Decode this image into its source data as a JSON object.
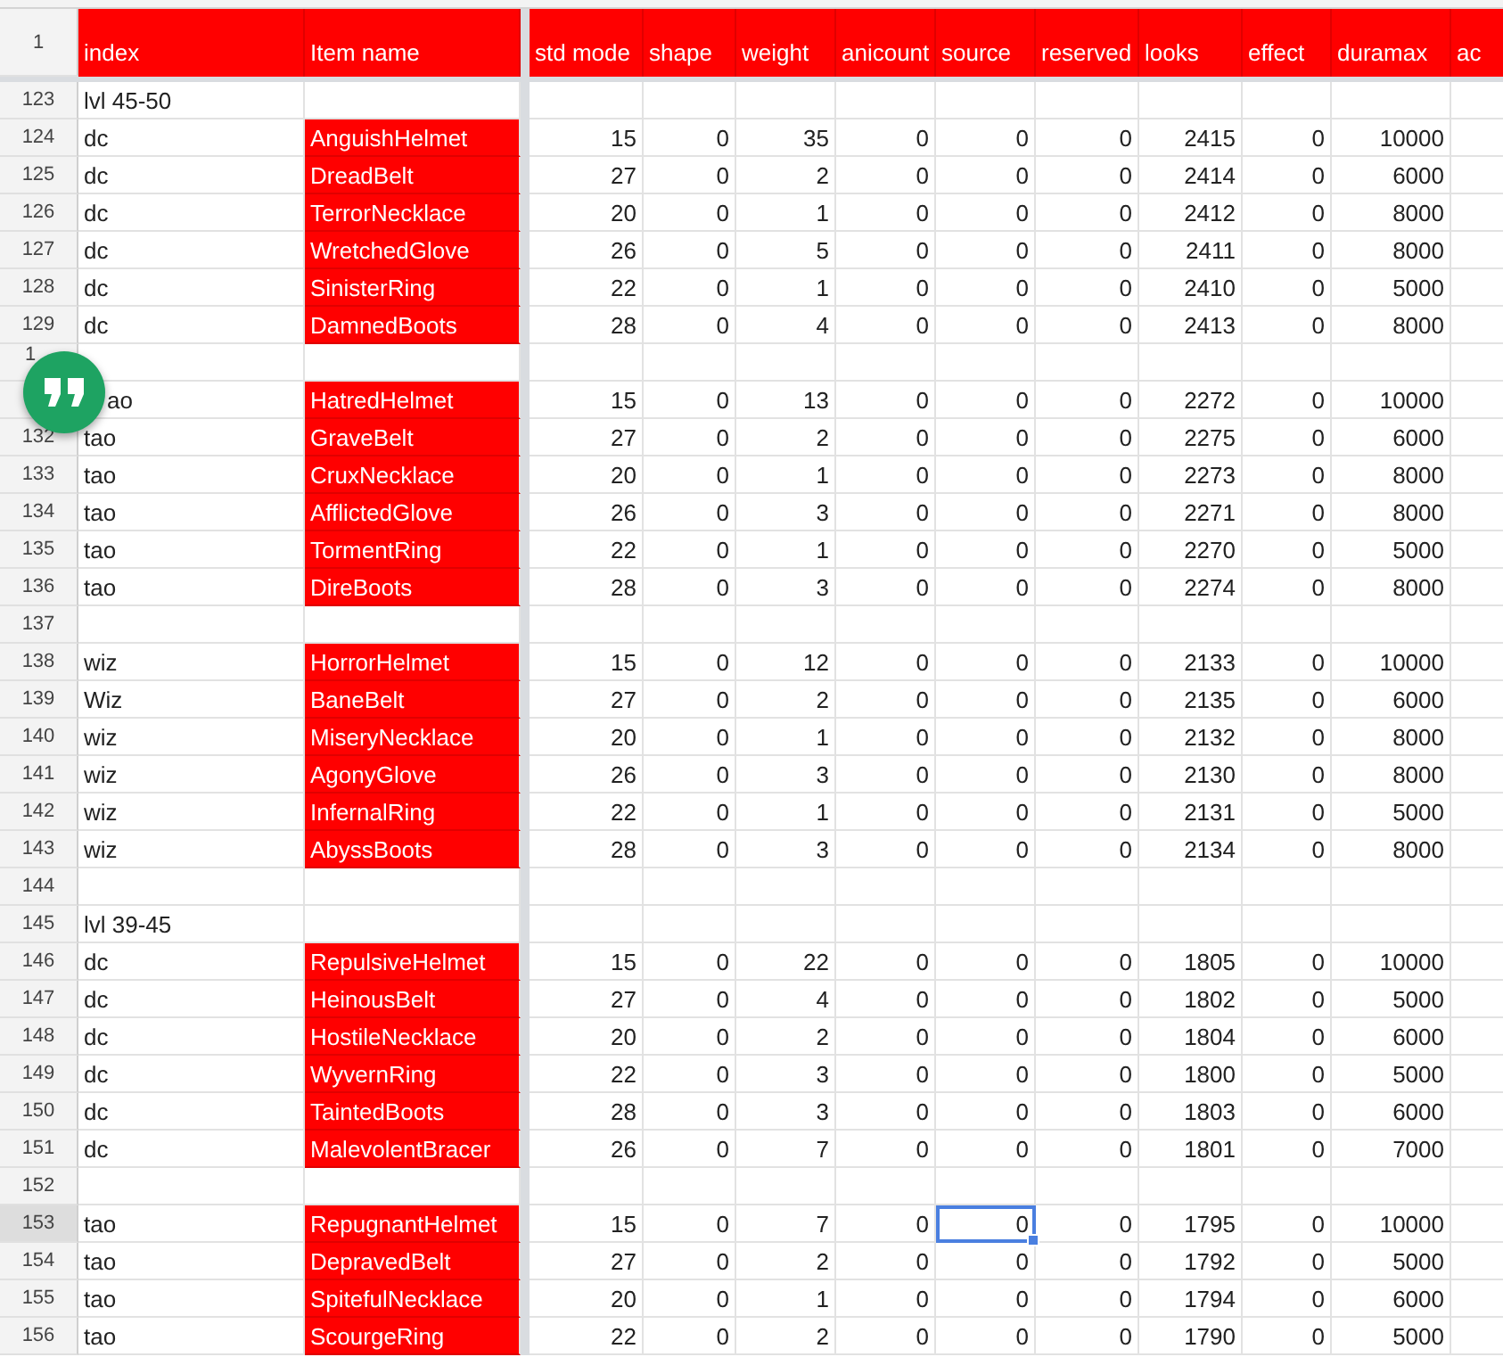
{
  "header_row": {
    "number": "1",
    "columns": [
      "index",
      "Item name",
      "std mode",
      "shape",
      "weight",
      "anicount",
      "source",
      "reserved",
      "looks",
      "effect",
      "duramax",
      "ac"
    ]
  },
  "rows": [
    {
      "number": "123",
      "selected": false,
      "index": "lvl 45-50",
      "item": "",
      "cells": []
    },
    {
      "number": "124",
      "selected": false,
      "index": "dc",
      "item": "AnguishHelmet",
      "cells": [
        {
          "text": "15",
          "selected": false
        },
        {
          "text": "0",
          "selected": false
        },
        {
          "text": "35",
          "selected": false
        },
        {
          "text": "0",
          "selected": false
        },
        {
          "text": "0",
          "selected": false
        },
        {
          "text": "0",
          "selected": false
        },
        {
          "text": "2415",
          "selected": false
        },
        {
          "text": "0",
          "selected": false
        },
        {
          "text": "10000",
          "selected": false
        }
      ]
    },
    {
      "number": "125",
      "selected": false,
      "index": "dc",
      "item": "DreadBelt",
      "cells": [
        {
          "text": "27",
          "selected": false
        },
        {
          "text": "0",
          "selected": false
        },
        {
          "text": "2",
          "selected": false
        },
        {
          "text": "0",
          "selected": false
        },
        {
          "text": "0",
          "selected": false
        },
        {
          "text": "0",
          "selected": false
        },
        {
          "text": "2414",
          "selected": false
        },
        {
          "text": "0",
          "selected": false
        },
        {
          "text": "6000",
          "selected": false
        }
      ]
    },
    {
      "number": "126",
      "selected": false,
      "index": "dc",
      "item": "TerrorNecklace",
      "cells": [
        {
          "text": "20",
          "selected": false
        },
        {
          "text": "0",
          "selected": false
        },
        {
          "text": "1",
          "selected": false
        },
        {
          "text": "0",
          "selected": false
        },
        {
          "text": "0",
          "selected": false
        },
        {
          "text": "0",
          "selected": false
        },
        {
          "text": "2412",
          "selected": false
        },
        {
          "text": "0",
          "selected": false
        },
        {
          "text": "8000",
          "selected": false
        }
      ]
    },
    {
      "number": "127",
      "selected": false,
      "index": "dc",
      "item": "WretchedGlove",
      "cells": [
        {
          "text": "26",
          "selected": false
        },
        {
          "text": "0",
          "selected": false
        },
        {
          "text": "5",
          "selected": false
        },
        {
          "text": "0",
          "selected": false
        },
        {
          "text": "0",
          "selected": false
        },
        {
          "text": "0",
          "selected": false
        },
        {
          "text": "2411",
          "selected": false
        },
        {
          "text": "0",
          "selected": false
        },
        {
          "text": "8000",
          "selected": false
        }
      ]
    },
    {
      "number": "128",
      "selected": false,
      "index": "dc",
      "item": "SinisterRing",
      "cells": [
        {
          "text": "22",
          "selected": false
        },
        {
          "text": "0",
          "selected": false
        },
        {
          "text": "1",
          "selected": false
        },
        {
          "text": "0",
          "selected": false
        },
        {
          "text": "0",
          "selected": false
        },
        {
          "text": "0",
          "selected": false
        },
        {
          "text": "2410",
          "selected": false
        },
        {
          "text": "0",
          "selected": false
        },
        {
          "text": "5000",
          "selected": false
        }
      ]
    },
    {
      "number": "129",
      "selected": false,
      "index": "dc",
      "item": "DamnedBoots",
      "cells": [
        {
          "text": "28",
          "selected": false
        },
        {
          "text": "0",
          "selected": false
        },
        {
          "text": "4",
          "selected": false
        },
        {
          "text": "0",
          "selected": false
        },
        {
          "text": "0",
          "selected": false
        },
        {
          "text": "0",
          "selected": false
        },
        {
          "text": "2413",
          "selected": false
        },
        {
          "text": "0",
          "selected": false
        },
        {
          "text": "8000",
          "selected": false
        }
      ]
    },
    {
      "number": "1",
      "selected": false,
      "index": "",
      "item": "",
      "cells": []
    },
    {
      "number": "",
      "selected": false,
      "index": "ao",
      "item": "HatredHelmet",
      "cells": [
        {
          "text": "15",
          "selected": false
        },
        {
          "text": "0",
          "selected": false
        },
        {
          "text": "13",
          "selected": false
        },
        {
          "text": "0",
          "selected": false
        },
        {
          "text": "0",
          "selected": false
        },
        {
          "text": "0",
          "selected": false
        },
        {
          "text": "2272",
          "selected": false
        },
        {
          "text": "0",
          "selected": false
        },
        {
          "text": "10000",
          "selected": false
        }
      ]
    },
    {
      "number": "132",
      "selected": false,
      "index": "tao",
      "item": "GraveBelt",
      "cells": [
        {
          "text": "27",
          "selected": false
        },
        {
          "text": "0",
          "selected": false
        },
        {
          "text": "2",
          "selected": false
        },
        {
          "text": "0",
          "selected": false
        },
        {
          "text": "0",
          "selected": false
        },
        {
          "text": "0",
          "selected": false
        },
        {
          "text": "2275",
          "selected": false
        },
        {
          "text": "0",
          "selected": false
        },
        {
          "text": "6000",
          "selected": false
        }
      ]
    },
    {
      "number": "133",
      "selected": false,
      "index": "tao",
      "item": "CruxNecklace",
      "cells": [
        {
          "text": "20",
          "selected": false
        },
        {
          "text": "0",
          "selected": false
        },
        {
          "text": "1",
          "selected": false
        },
        {
          "text": "0",
          "selected": false
        },
        {
          "text": "0",
          "selected": false
        },
        {
          "text": "0",
          "selected": false
        },
        {
          "text": "2273",
          "selected": false
        },
        {
          "text": "0",
          "selected": false
        },
        {
          "text": "8000",
          "selected": false
        }
      ]
    },
    {
      "number": "134",
      "selected": false,
      "index": "tao",
      "item": "AfflictedGlove",
      "cells": [
        {
          "text": "26",
          "selected": false
        },
        {
          "text": "0",
          "selected": false
        },
        {
          "text": "3",
          "selected": false
        },
        {
          "text": "0",
          "selected": false
        },
        {
          "text": "0",
          "selected": false
        },
        {
          "text": "0",
          "selected": false
        },
        {
          "text": "2271",
          "selected": false
        },
        {
          "text": "0",
          "selected": false
        },
        {
          "text": "8000",
          "selected": false
        }
      ]
    },
    {
      "number": "135",
      "selected": false,
      "index": "tao",
      "item": "TormentRing",
      "cells": [
        {
          "text": "22",
          "selected": false
        },
        {
          "text": "0",
          "selected": false
        },
        {
          "text": "1",
          "selected": false
        },
        {
          "text": "0",
          "selected": false
        },
        {
          "text": "0",
          "selected": false
        },
        {
          "text": "0",
          "selected": false
        },
        {
          "text": "2270",
          "selected": false
        },
        {
          "text": "0",
          "selected": false
        },
        {
          "text": "5000",
          "selected": false
        }
      ]
    },
    {
      "number": "136",
      "selected": false,
      "index": "tao",
      "item": "DireBoots",
      "cells": [
        {
          "text": "28",
          "selected": false
        },
        {
          "text": "0",
          "selected": false
        },
        {
          "text": "3",
          "selected": false
        },
        {
          "text": "0",
          "selected": false
        },
        {
          "text": "0",
          "selected": false
        },
        {
          "text": "0",
          "selected": false
        },
        {
          "text": "2274",
          "selected": false
        },
        {
          "text": "0",
          "selected": false
        },
        {
          "text": "8000",
          "selected": false
        }
      ]
    },
    {
      "number": "137",
      "selected": false,
      "index": "",
      "item": "",
      "cells": []
    },
    {
      "number": "138",
      "selected": false,
      "index": "wiz",
      "item": "HorrorHelmet",
      "cells": [
        {
          "text": "15",
          "selected": false
        },
        {
          "text": "0",
          "selected": false
        },
        {
          "text": "12",
          "selected": false
        },
        {
          "text": "0",
          "selected": false
        },
        {
          "text": "0",
          "selected": false
        },
        {
          "text": "0",
          "selected": false
        },
        {
          "text": "2133",
          "selected": false
        },
        {
          "text": "0",
          "selected": false
        },
        {
          "text": "10000",
          "selected": false
        }
      ]
    },
    {
      "number": "139",
      "selected": false,
      "index": "Wiz",
      "item": "BaneBelt",
      "cells": [
        {
          "text": "27",
          "selected": false
        },
        {
          "text": "0",
          "selected": false
        },
        {
          "text": "2",
          "selected": false
        },
        {
          "text": "0",
          "selected": false
        },
        {
          "text": "0",
          "selected": false
        },
        {
          "text": "0",
          "selected": false
        },
        {
          "text": "2135",
          "selected": false
        },
        {
          "text": "0",
          "selected": false
        },
        {
          "text": "6000",
          "selected": false
        }
      ]
    },
    {
      "number": "140",
      "selected": false,
      "index": "wiz",
      "item": "MiseryNecklace",
      "cells": [
        {
          "text": "20",
          "selected": false
        },
        {
          "text": "0",
          "selected": false
        },
        {
          "text": "1",
          "selected": false
        },
        {
          "text": "0",
          "selected": false
        },
        {
          "text": "0",
          "selected": false
        },
        {
          "text": "0",
          "selected": false
        },
        {
          "text": "2132",
          "selected": false
        },
        {
          "text": "0",
          "selected": false
        },
        {
          "text": "8000",
          "selected": false
        }
      ]
    },
    {
      "number": "141",
      "selected": false,
      "index": "wiz",
      "item": "AgonyGlove",
      "cells": [
        {
          "text": "26",
          "selected": false
        },
        {
          "text": "0",
          "selected": false
        },
        {
          "text": "3",
          "selected": false
        },
        {
          "text": "0",
          "selected": false
        },
        {
          "text": "0",
          "selected": false
        },
        {
          "text": "0",
          "selected": false
        },
        {
          "text": "2130",
          "selected": false
        },
        {
          "text": "0",
          "selected": false
        },
        {
          "text": "8000",
          "selected": false
        }
      ]
    },
    {
      "number": "142",
      "selected": false,
      "index": "wiz",
      "item": "InfernalRing",
      "cells": [
        {
          "text": "22",
          "selected": false
        },
        {
          "text": "0",
          "selected": false
        },
        {
          "text": "1",
          "selected": false
        },
        {
          "text": "0",
          "selected": false
        },
        {
          "text": "0",
          "selected": false
        },
        {
          "text": "0",
          "selected": false
        },
        {
          "text": "2131",
          "selected": false
        },
        {
          "text": "0",
          "selected": false
        },
        {
          "text": "5000",
          "selected": false
        }
      ]
    },
    {
      "number": "143",
      "selected": false,
      "index": "wiz",
      "item": "AbyssBoots",
      "cells": [
        {
          "text": "28",
          "selected": false
        },
        {
          "text": "0",
          "selected": false
        },
        {
          "text": "3",
          "selected": false
        },
        {
          "text": "0",
          "selected": false
        },
        {
          "text": "0",
          "selected": false
        },
        {
          "text": "0",
          "selected": false
        },
        {
          "text": "2134",
          "selected": false
        },
        {
          "text": "0",
          "selected": false
        },
        {
          "text": "8000",
          "selected": false
        }
      ]
    },
    {
      "number": "144",
      "selected": false,
      "index": "",
      "item": "",
      "cells": []
    },
    {
      "number": "145",
      "selected": false,
      "index": "lvl 39-45",
      "item": "",
      "cells": []
    },
    {
      "number": "146",
      "selected": false,
      "index": "dc",
      "item": "RepulsiveHelmet",
      "cells": [
        {
          "text": "15",
          "selected": false
        },
        {
          "text": "0",
          "selected": false
        },
        {
          "text": "22",
          "selected": false
        },
        {
          "text": "0",
          "selected": false
        },
        {
          "text": "0",
          "selected": false
        },
        {
          "text": "0",
          "selected": false
        },
        {
          "text": "1805",
          "selected": false
        },
        {
          "text": "0",
          "selected": false
        },
        {
          "text": "10000",
          "selected": false
        }
      ]
    },
    {
      "number": "147",
      "selected": false,
      "index": "dc",
      "item": "HeinousBelt",
      "cells": [
        {
          "text": "27",
          "selected": false
        },
        {
          "text": "0",
          "selected": false
        },
        {
          "text": "4",
          "selected": false
        },
        {
          "text": "0",
          "selected": false
        },
        {
          "text": "0",
          "selected": false
        },
        {
          "text": "0",
          "selected": false
        },
        {
          "text": "1802",
          "selected": false
        },
        {
          "text": "0",
          "selected": false
        },
        {
          "text": "5000",
          "selected": false
        }
      ]
    },
    {
      "number": "148",
      "selected": false,
      "index": "dc",
      "item": "HostileNecklace",
      "cells": [
        {
          "text": "20",
          "selected": false
        },
        {
          "text": "0",
          "selected": false
        },
        {
          "text": "2",
          "selected": false
        },
        {
          "text": "0",
          "selected": false
        },
        {
          "text": "0",
          "selected": false
        },
        {
          "text": "0",
          "selected": false
        },
        {
          "text": "1804",
          "selected": false
        },
        {
          "text": "0",
          "selected": false
        },
        {
          "text": "6000",
          "selected": false
        }
      ]
    },
    {
      "number": "149",
      "selected": false,
      "index": "dc",
      "item": "WyvernRing",
      "cells": [
        {
          "text": "22",
          "selected": false
        },
        {
          "text": "0",
          "selected": false
        },
        {
          "text": "3",
          "selected": false
        },
        {
          "text": "0",
          "selected": false
        },
        {
          "text": "0",
          "selected": false
        },
        {
          "text": "0",
          "selected": false
        },
        {
          "text": "1800",
          "selected": false
        },
        {
          "text": "0",
          "selected": false
        },
        {
          "text": "5000",
          "selected": false
        }
      ]
    },
    {
      "number": "150",
      "selected": false,
      "index": "dc",
      "item": "TaintedBoots",
      "cells": [
        {
          "text": "28",
          "selected": false
        },
        {
          "text": "0",
          "selected": false
        },
        {
          "text": "3",
          "selected": false
        },
        {
          "text": "0",
          "selected": false
        },
        {
          "text": "0",
          "selected": false
        },
        {
          "text": "0",
          "selected": false
        },
        {
          "text": "1803",
          "selected": false
        },
        {
          "text": "0",
          "selected": false
        },
        {
          "text": "6000",
          "selected": false
        }
      ]
    },
    {
      "number": "151",
      "selected": false,
      "index": "dc",
      "item": "MalevolentBracer",
      "cells": [
        {
          "text": "26",
          "selected": false
        },
        {
          "text": "0",
          "selected": false
        },
        {
          "text": "7",
          "selected": false
        },
        {
          "text": "0",
          "selected": false
        },
        {
          "text": "0",
          "selected": false
        },
        {
          "text": "0",
          "selected": false
        },
        {
          "text": "1801",
          "selected": false
        },
        {
          "text": "0",
          "selected": false
        },
        {
          "text": "7000",
          "selected": false
        }
      ]
    },
    {
      "number": "152",
      "selected": false,
      "index": "",
      "item": "",
      "cells": []
    },
    {
      "number": "153",
      "selected": true,
      "index": "tao",
      "item": "RepugnantHelmet",
      "cells": [
        {
          "text": "15",
          "selected": false
        },
        {
          "text": "0",
          "selected": false
        },
        {
          "text": "7",
          "selected": false
        },
        {
          "text": "0",
          "selected": false
        },
        {
          "text": "0",
          "selected": true
        },
        {
          "text": "0",
          "selected": false
        },
        {
          "text": "1795",
          "selected": false
        },
        {
          "text": "0",
          "selected": false
        },
        {
          "text": "10000",
          "selected": false
        }
      ]
    },
    {
      "number": "154",
      "selected": false,
      "index": "tao",
      "item": "DepravedBelt",
      "cells": [
        {
          "text": "27",
          "selected": false
        },
        {
          "text": "0",
          "selected": false
        },
        {
          "text": "2",
          "selected": false
        },
        {
          "text": "0",
          "selected": false
        },
        {
          "text": "0",
          "selected": false
        },
        {
          "text": "0",
          "selected": false
        },
        {
          "text": "1792",
          "selected": false
        },
        {
          "text": "0",
          "selected": false
        },
        {
          "text": "5000",
          "selected": false
        }
      ]
    },
    {
      "number": "155",
      "selected": false,
      "index": "tao",
      "item": "SpitefulNecklace",
      "cells": [
        {
          "text": "20",
          "selected": false
        },
        {
          "text": "0",
          "selected": false
        },
        {
          "text": "1",
          "selected": false
        },
        {
          "text": "0",
          "selected": false
        },
        {
          "text": "0",
          "selected": false
        },
        {
          "text": "0",
          "selected": false
        },
        {
          "text": "1794",
          "selected": false
        },
        {
          "text": "0",
          "selected": false
        },
        {
          "text": "6000",
          "selected": false
        }
      ]
    },
    {
      "number": "156",
      "selected": false,
      "index": "tao",
      "item": "ScourgeRing",
      "cells": [
        {
          "text": "22",
          "selected": false
        },
        {
          "text": "0",
          "selected": false
        },
        {
          "text": "2",
          "selected": false
        },
        {
          "text": "0",
          "selected": false
        },
        {
          "text": "0",
          "selected": false
        },
        {
          "text": "0",
          "selected": false
        },
        {
          "text": "1790",
          "selected": false
        },
        {
          "text": "0",
          "selected": false
        },
        {
          "text": "5000",
          "selected": false
        }
      ]
    }
  ]
}
